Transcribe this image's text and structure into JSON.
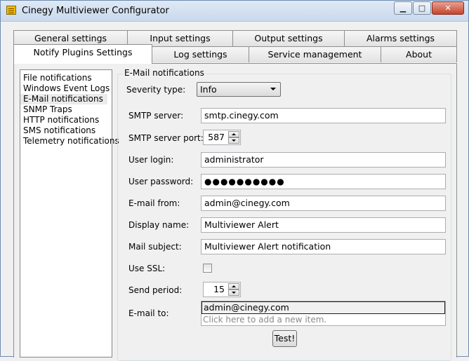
{
  "window": {
    "title": "Cinegy Multiviewer Configurator",
    "min_glyph": "▁",
    "max_glyph": "□",
    "close_glyph": "✕"
  },
  "tabs": {
    "row_back": [
      "General settings",
      "Input settings",
      "Output settings",
      "Alarms settings"
    ],
    "row_front": [
      "Notify Plugins Settings",
      "Log settings",
      "Service management",
      "About"
    ],
    "active": "Notify Plugins Settings"
  },
  "plugins": {
    "items": [
      "File notifications",
      "Windows Event Logs",
      "E-Mail notifications",
      "SNMP Traps",
      "HTTP notifications",
      "SMS notifications",
      "Telemetry notifications"
    ],
    "selected": "E-Mail notifications"
  },
  "email": {
    "group_title": "E-Mail notifications",
    "severity_label": "Severity type:",
    "severity_value": "Info",
    "smtp_server_label": "SMTP server:",
    "smtp_server_value": "smtp.cinegy.com",
    "smtp_port_label": "SMTP server port:",
    "smtp_port_value": "587",
    "user_login_label": "User login:",
    "user_login_value": "administrator",
    "user_password_label": "User password:",
    "user_password_value": "●●●●●●●●●●",
    "email_from_label": "E-mail from:",
    "email_from_value": "admin@cinegy.com",
    "display_name_label": "Display name:",
    "display_name_value": "Multiviewer Alert",
    "mail_subject_label": "Mail subject:",
    "mail_subject_value": "Multiviewer Alert notification",
    "use_ssl_label": "Use SSL:",
    "use_ssl_checked": false,
    "send_period_label": "Send period:",
    "send_period_value": "15",
    "email_to_label": "E-mail to:",
    "email_to_items": [
      "admin@cinegy.com"
    ],
    "email_to_placeholder": "Click here to add a new item.",
    "test_button": "Test!"
  }
}
